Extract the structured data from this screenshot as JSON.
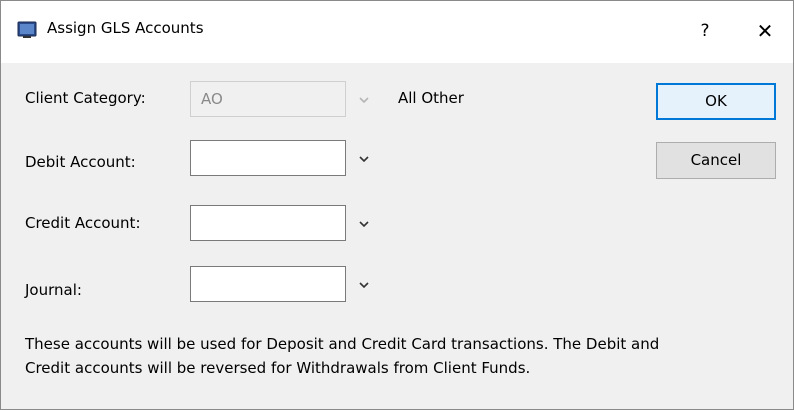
{
  "window": {
    "title": "Assign GLS Accounts",
    "help_glyph": "?",
    "close_glyph": "✕"
  },
  "form": {
    "client_category": {
      "label": "Client Category:",
      "value": "AO",
      "description": "All Other"
    },
    "debit_account": {
      "label": "Debit Account:",
      "value": ""
    },
    "credit_account": {
      "label": "Credit Account:",
      "value": ""
    },
    "journal": {
      "label": "Journal:",
      "value": ""
    }
  },
  "buttons": {
    "ok": "OK",
    "cancel": "Cancel"
  },
  "note": {
    "line1": "These accounts will be used for Deposit and Credit Card transactions. The Debit and",
    "line2": "Credit accounts will be reversed for Withdrawals from Client Funds."
  },
  "colors": {
    "accent": "#0078d7",
    "dialog_bg": "#f0f0f0"
  },
  "icons": {
    "app": "app-window-icon",
    "chevron": "chevron-down-icon"
  }
}
